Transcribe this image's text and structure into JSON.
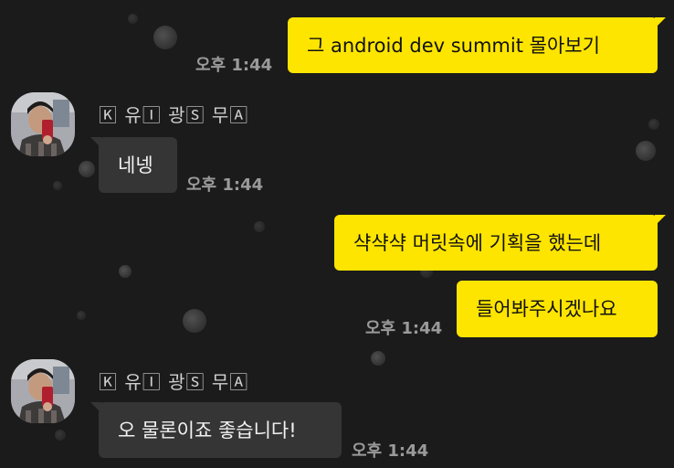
{
  "theme": {
    "background": "#1b1b1b",
    "my_bubble": "#fee500",
    "their_bubble": "#353535",
    "timestamp": "#9a9a9a"
  },
  "messages": [
    {
      "from": "me",
      "text": "그 android dev summit 몰아보기",
      "time": "오후 1:44"
    },
    {
      "from": "them",
      "sender": "🄺 유🄸 광🅂 무🄰",
      "text": "네넹",
      "time": "오후 1:44"
    },
    {
      "from": "me",
      "text": "샥샥샥 머릿속에 기획을 했는데",
      "time": ""
    },
    {
      "from": "me",
      "text": "들어봐주시겠나요",
      "time": "오후 1:44"
    },
    {
      "from": "them",
      "sender": "🄺 유🄸 광🅂 무🄰",
      "text": "오 물론이죠 좋습니다!",
      "time": "오후 1:44"
    }
  ]
}
